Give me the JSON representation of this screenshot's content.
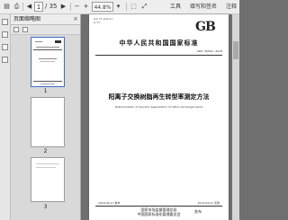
{
  "toolbar": {
    "page_current": "1",
    "page_total": "/ 35",
    "zoom": "44.8%",
    "tools_label": "工具",
    "sign_label": "填写和签名",
    "comment_label": "注释"
  },
  "panel": {
    "title": "页面缩略图",
    "close": "×",
    "pages": [
      "1",
      "2",
      "3"
    ]
  },
  "document": {
    "top_meta": "ICS 71.100.01\nG 77",
    "logo": "GB",
    "country": "中华人民共和国国家标准",
    "std_no": "GB/T 36769—2018",
    "title_cn": "阳离子交换树脂再生转型率测定方法",
    "title_en": "Determination of percent regeneration of cation exchange resins",
    "issue_date": "2018-09-17 发布",
    "effective_date": "2019-04-01 实施",
    "issuer_line1": "国家市场监督管理总局",
    "issuer_line2": "中国国家标准化管理委员会",
    "issuer_suffix": "发布"
  }
}
